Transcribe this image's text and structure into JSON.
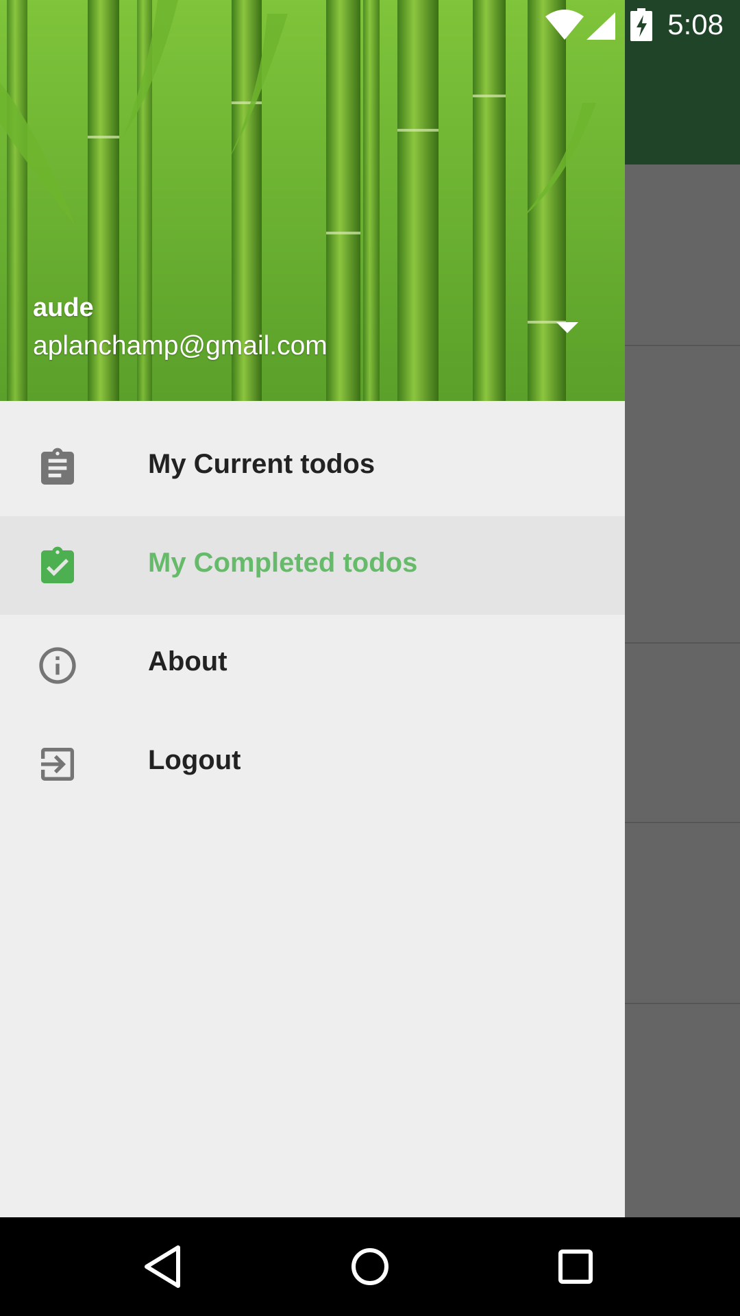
{
  "status_bar": {
    "time": "5:08",
    "icons": [
      "wifi-icon",
      "signal-icon",
      "battery-charging-icon"
    ]
  },
  "colors": {
    "accent": "#66bb6a",
    "toolbar": "#1f4427",
    "drawer_bg": "#eeeeee",
    "active_bg": "#e4e4e4"
  },
  "drawer": {
    "header": {
      "name": "aude",
      "email": "aplanchamp@gmail.com"
    },
    "items": [
      {
        "label": "My Current todos",
        "icon": "clipboard-icon",
        "active": false
      },
      {
        "label": "My Completed todos",
        "icon": "clipboard-check-icon",
        "active": true
      },
      {
        "label": "About",
        "icon": "info-icon",
        "active": false
      },
      {
        "label": "Logout",
        "icon": "logout-icon",
        "active": false
      }
    ]
  },
  "nav_bar": {
    "buttons": [
      "back-icon",
      "home-icon",
      "recents-icon"
    ]
  }
}
